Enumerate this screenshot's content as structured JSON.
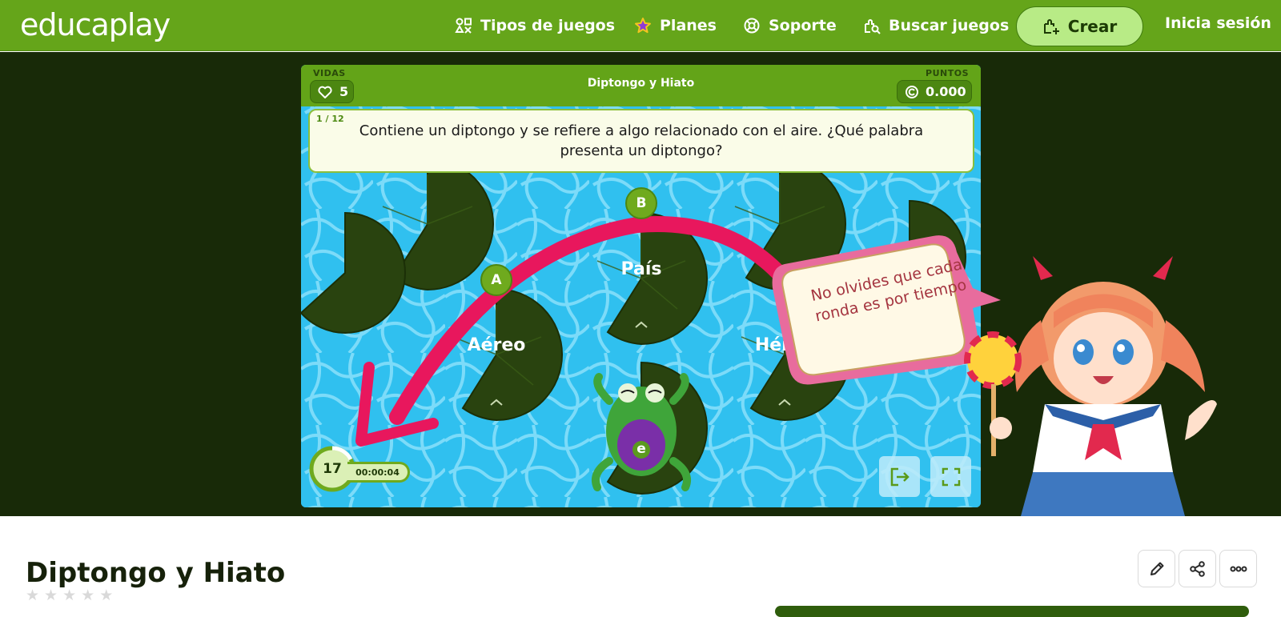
{
  "nav": {
    "logo": "educaplay",
    "items": [
      {
        "label": "Tipos de juegos",
        "icon": "grid-shapes-icon"
      },
      {
        "label": "Planes",
        "icon": "star-icon"
      },
      {
        "label": "Soporte",
        "icon": "lifebuoy-icon"
      },
      {
        "label": "Buscar juegos",
        "icon": "search-puzzle-icon"
      }
    ],
    "create_label": "Crear",
    "login_label": "Inicia sesión"
  },
  "game": {
    "lives_label": "VIDAS",
    "lives_value": "5",
    "points_label": "PUNTOS",
    "points_value": "0.000",
    "title": "Diptongo y Hiato",
    "question_counter": "1 / 12",
    "question": "Contiene un diptongo y se refiere a algo relacionado con el aire. ¿Qué palabra presenta un diptongo?",
    "answers": [
      {
        "badge": "A",
        "label": "Aéreo"
      },
      {
        "badge": "B",
        "label": "País"
      },
      {
        "badge": "",
        "label": "Héroe"
      }
    ],
    "frog_badge": "e",
    "timer_seconds": "17",
    "timer_elapsed": "00:00:04",
    "hint": "No olvides que cada ronda es por tiempo"
  },
  "activity": {
    "title": "Diptongo y Hiato",
    "rating_stars": 0,
    "rating_max": 5
  },
  "colors": {
    "brand_green": "#65a51a",
    "stage_bg": "#182a08",
    "water": "#31c2f0",
    "lilypad": "#29430f",
    "arrow": "#e8175d"
  }
}
